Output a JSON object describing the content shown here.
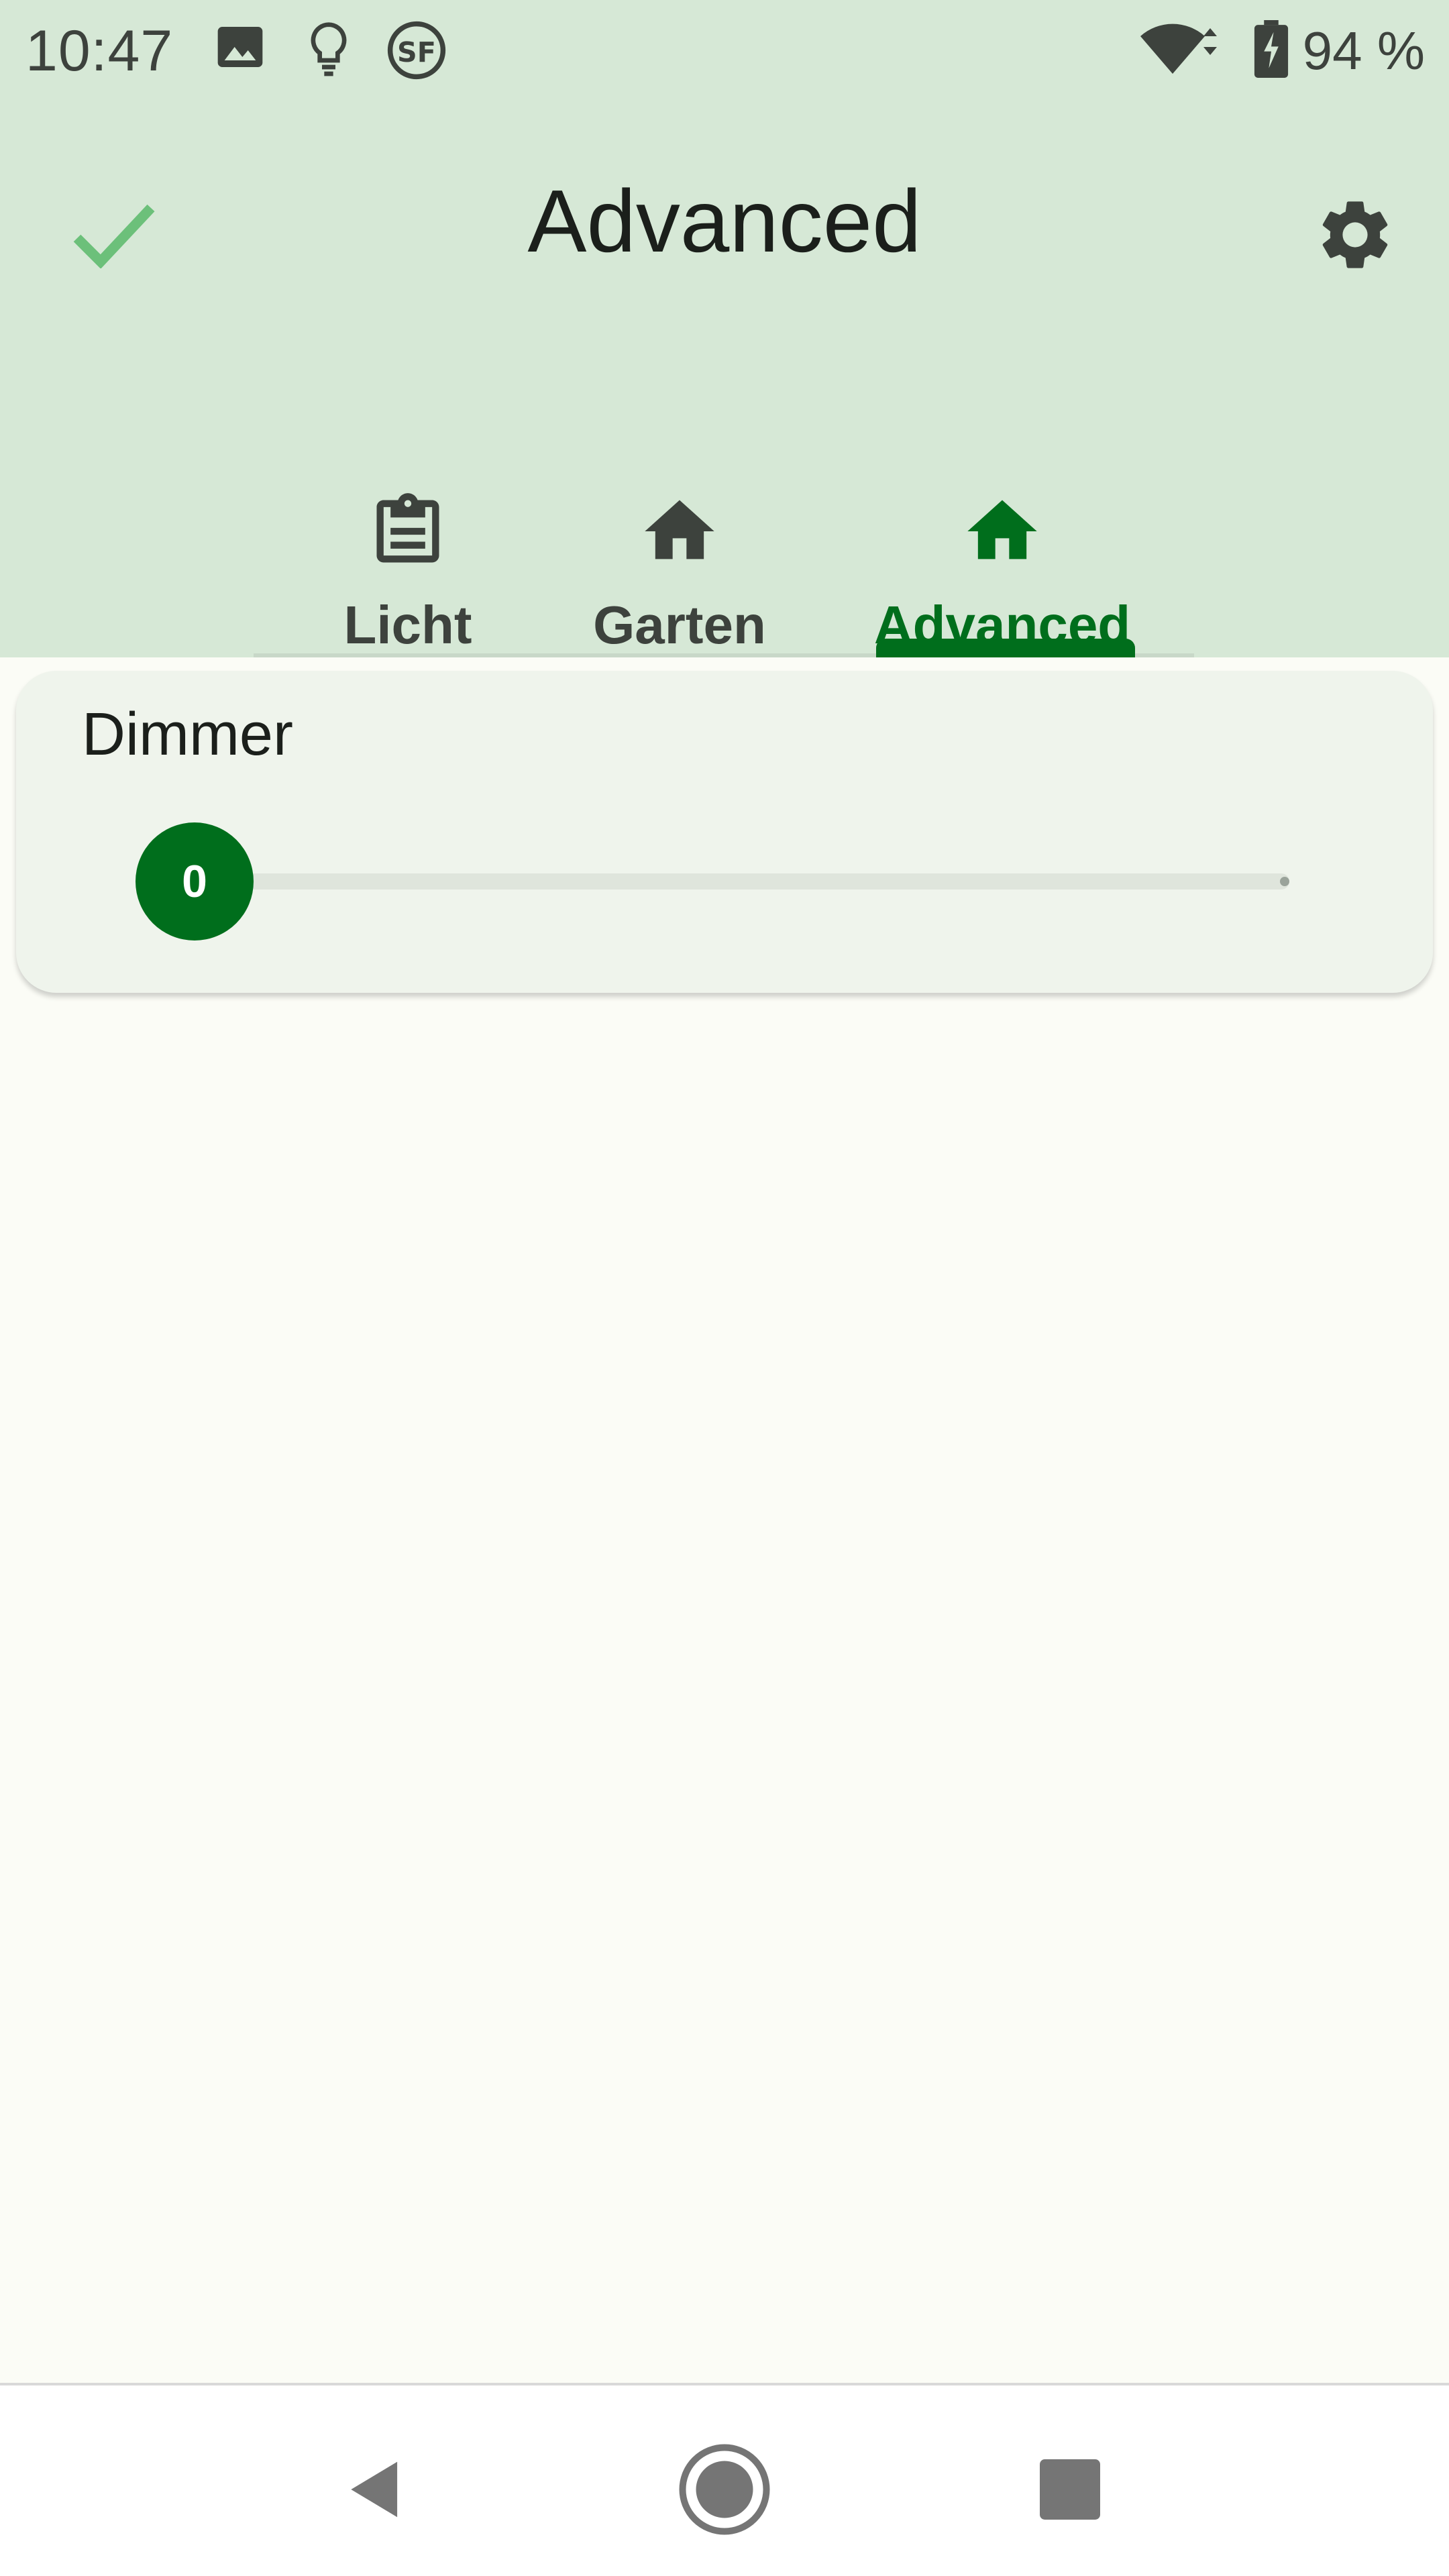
{
  "status_bar": {
    "time": "10:47",
    "battery": "94 %",
    "icons": [
      "image-icon",
      "lightbulb-icon",
      "sf-app-icon",
      "wifi-icon",
      "battery-charging-icon"
    ]
  },
  "app_bar": {
    "title": "Advanced",
    "confirm_icon": "check-icon",
    "settings_icon": "gear-icon"
  },
  "tabs": [
    {
      "label": "Licht",
      "icon": "clipboard-icon",
      "active": false
    },
    {
      "label": "Garten",
      "icon": "home-icon",
      "active": false
    },
    {
      "label": "Advanced",
      "icon": "home-icon",
      "active": true
    }
  ],
  "dimmer": {
    "title": "Dimmer",
    "value_label": "0",
    "value": 0
  },
  "nav_bar": {
    "icons": [
      "back-icon",
      "home-circle-icon",
      "recents-icon"
    ]
  },
  "colors": {
    "accent": "#006e1c",
    "header_bg": "#d6e8d6",
    "card_bg": "#eff4ec",
    "check": "#6cc07a"
  }
}
